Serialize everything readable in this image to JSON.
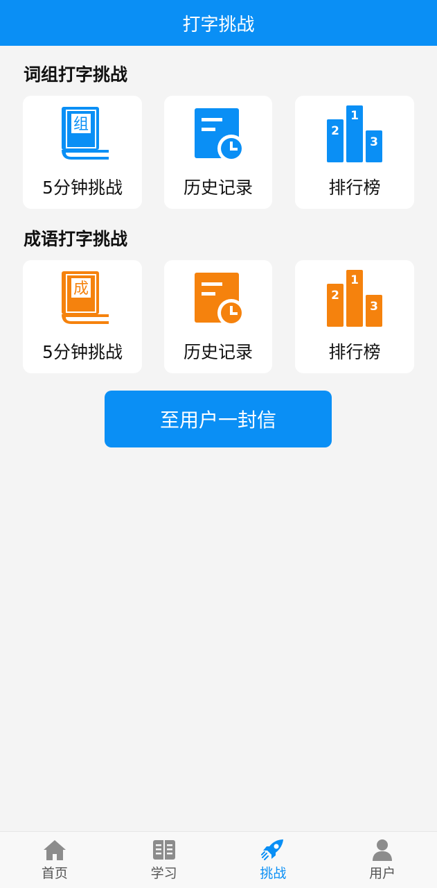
{
  "header": {
    "title": "打字挑战"
  },
  "sections": [
    {
      "title": "词组打字挑战",
      "color": "#0a8ff5",
      "book_char": "组",
      "items": [
        {
          "label": "5分钟挑战",
          "icon": "book-icon"
        },
        {
          "label": "历史记录",
          "icon": "history-icon"
        },
        {
          "label": "排行榜",
          "icon": "podium-icon"
        }
      ]
    },
    {
      "title": "成语打字挑战",
      "color": "#f5820d",
      "book_char": "成",
      "items": [
        {
          "label": "5分钟挑战",
          "icon": "book-icon"
        },
        {
          "label": "历史记录",
          "icon": "history-icon"
        },
        {
          "label": "排行榜",
          "icon": "podium-icon"
        }
      ]
    }
  ],
  "podium_ranks": [
    "1",
    "2",
    "3"
  ],
  "letter_button": {
    "label": "至用户一封信"
  },
  "tabbar": {
    "active_color": "#0a8ff5",
    "inactive_color": "#8c8c8c",
    "items": [
      {
        "label": "首页",
        "icon": "home-icon",
        "active": false
      },
      {
        "label": "学习",
        "icon": "book-open-icon",
        "active": false
      },
      {
        "label": "挑战",
        "icon": "rocket-icon",
        "active": true
      },
      {
        "label": "用户",
        "icon": "user-icon",
        "active": false
      }
    ]
  }
}
